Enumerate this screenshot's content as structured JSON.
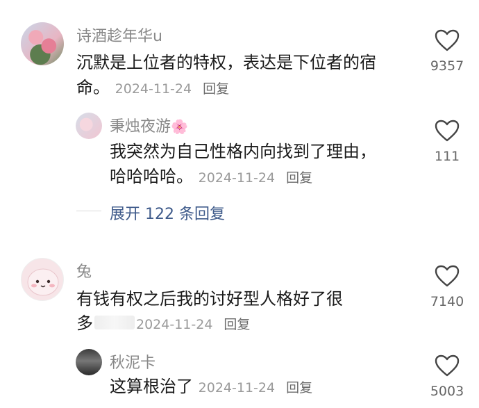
{
  "comments": [
    {
      "user": "诗酒趁年华u",
      "text_line1": "沉默是上位者的特权，表达是下位者的宿",
      "text_line2": "命。",
      "date": "2024-11-24",
      "reply_label": "回复",
      "likes": "9357",
      "icon": "heart-icon"
    },
    {
      "user": "秉烛夜游",
      "user_emoji": "🌸",
      "text_line1": "我突然为自己性格内向找到了理由，",
      "text_line2": "哈哈哈哈。",
      "date": "2024-11-24",
      "reply_label": "回复",
      "likes": "111",
      "icon": "heart-icon"
    },
    {
      "user": "兔",
      "text_line1": "有钱有权之后我的讨好型人格好了很",
      "text_line2": "多",
      "date": "2024-11-24",
      "reply_label": "回复",
      "likes": "7140",
      "icon": "heart-icon"
    },
    {
      "user": "秋泥卡",
      "text_line1": "这算根治了",
      "date": "2024-11-24",
      "reply_label": "回复",
      "likes": "5003",
      "icon": "heart-icon"
    }
  ],
  "expand_replies": "展开 122 条回复",
  "colors": {
    "name": "#888888",
    "link": "#3e5a8a",
    "text": "#1a1a1a"
  }
}
